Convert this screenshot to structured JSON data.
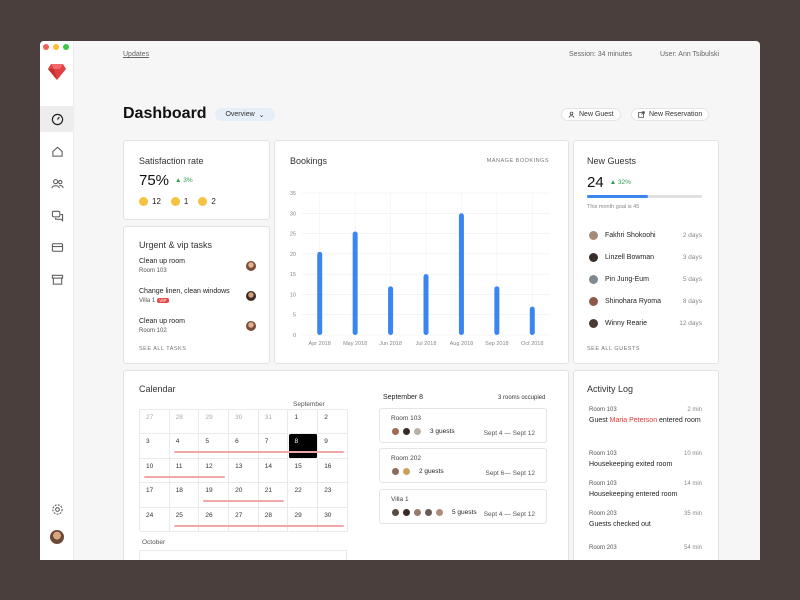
{
  "window_dots": [
    "#f25f58",
    "#fbbe2e",
    "#38c84a"
  ],
  "topbar": {
    "updates": "Updates",
    "session": "Session: 34 minutes",
    "user": "User: Ann Tsibulski"
  },
  "header": {
    "title": "Dashboard",
    "view": "Overview",
    "new_guest": "New Guest",
    "new_reservation": "New Reservation"
  },
  "satisfaction": {
    "title": "Satisfaction rate",
    "value": "75%",
    "change": "3%",
    "ratings": [
      {
        "icon": "happy-face-icon",
        "count": "12"
      },
      {
        "icon": "neutral-face-icon",
        "count": "1"
      },
      {
        "icon": "sad-face-icon",
        "count": "2"
      }
    ]
  },
  "tasks": {
    "title": "Urgent & vip tasks",
    "items": [
      {
        "title": "Clean up room",
        "room": "Room 103",
        "vip": ""
      },
      {
        "title": "Change linen, clean windows",
        "room": "Villa 1",
        "vip": "VIP"
      },
      {
        "title": "Clean up room",
        "room": "Room 102",
        "vip": ""
      }
    ],
    "see_all": "SEE ALL TASKS"
  },
  "bookings": {
    "title": "Bookings",
    "manage": "MANAGE BOOKINGS"
  },
  "chart_data": {
    "type": "bar",
    "categories": [
      "Apr 2018",
      "May 2018",
      "Jun 2018",
      "Jul 2018",
      "Aug 2018",
      "Sep 2018",
      "Oct 2018"
    ],
    "values": [
      20.5,
      25.5,
      12,
      15,
      30,
      12,
      7
    ],
    "yticks": [
      0,
      5,
      10,
      15,
      20,
      25,
      30,
      35
    ],
    "ylim": [
      0,
      35
    ],
    "grid": true,
    "color": "#3a86f0"
  },
  "new_guests": {
    "title": "New Guests",
    "value": "24",
    "change": "32%",
    "goal_text": "This month goal is 45",
    "progress": 0.53,
    "list": [
      {
        "name": "Fakhri Shokoohi",
        "duration": "2 days"
      },
      {
        "name": "Linzell Bowman",
        "duration": "3 days"
      },
      {
        "name": "Pin Jung-Eum",
        "duration": "5 days"
      },
      {
        "name": "Shinohara Ryoma",
        "duration": "8 days"
      },
      {
        "name": "Winny Rearie",
        "duration": "12 days"
      }
    ],
    "see_all": "SEE ALL GUESTS"
  },
  "calendar": {
    "title": "Calendar",
    "month": "September",
    "next_month": "October",
    "weeks": [
      [
        "27",
        "28",
        "29",
        "30",
        "31",
        "1",
        "2"
      ],
      [
        "3",
        "4",
        "5",
        "6",
        "7",
        "8",
        "9"
      ],
      [
        "10",
        "11",
        "12",
        "13",
        "14",
        "15",
        "16"
      ],
      [
        "17",
        "18",
        "19",
        "20",
        "21",
        "22",
        "23"
      ],
      [
        "24",
        "25",
        "26",
        "27",
        "28",
        "29",
        "30"
      ]
    ],
    "selected": "8"
  },
  "day": {
    "date": "September 8",
    "occupied": "3 rooms occupied",
    "rooms": [
      {
        "name": "Room 103",
        "guests": "3 guests",
        "dates": "Sept 4 — Sept 12"
      },
      {
        "name": "Room 202",
        "guests": "2 guests",
        "dates": "Sept 6— Sept 12"
      },
      {
        "name": "Villa 1",
        "guests": "5 guests",
        "dates": "Sept 4 — Sept 12"
      }
    ]
  },
  "activity": {
    "title": "Activity Log",
    "items": [
      {
        "room": "Room 103",
        "time": "2 min",
        "pre": "Guest ",
        "highlight": "Maria Peterson",
        "post": " entered room"
      },
      {
        "room": "Room 103",
        "time": "10 min",
        "pre": "Housekeeping exited room",
        "highlight": "",
        "post": ""
      },
      {
        "room": "Room 103",
        "time": "14 min",
        "pre": "Housekeeping entered room",
        "highlight": "",
        "post": ""
      },
      {
        "room": "Room 203",
        "time": "35 min",
        "pre": "Guests checked out",
        "highlight": "",
        "post": ""
      },
      {
        "room": "Room 203",
        "time": "54 min",
        "pre": "",
        "highlight": "",
        "post": ""
      }
    ]
  }
}
